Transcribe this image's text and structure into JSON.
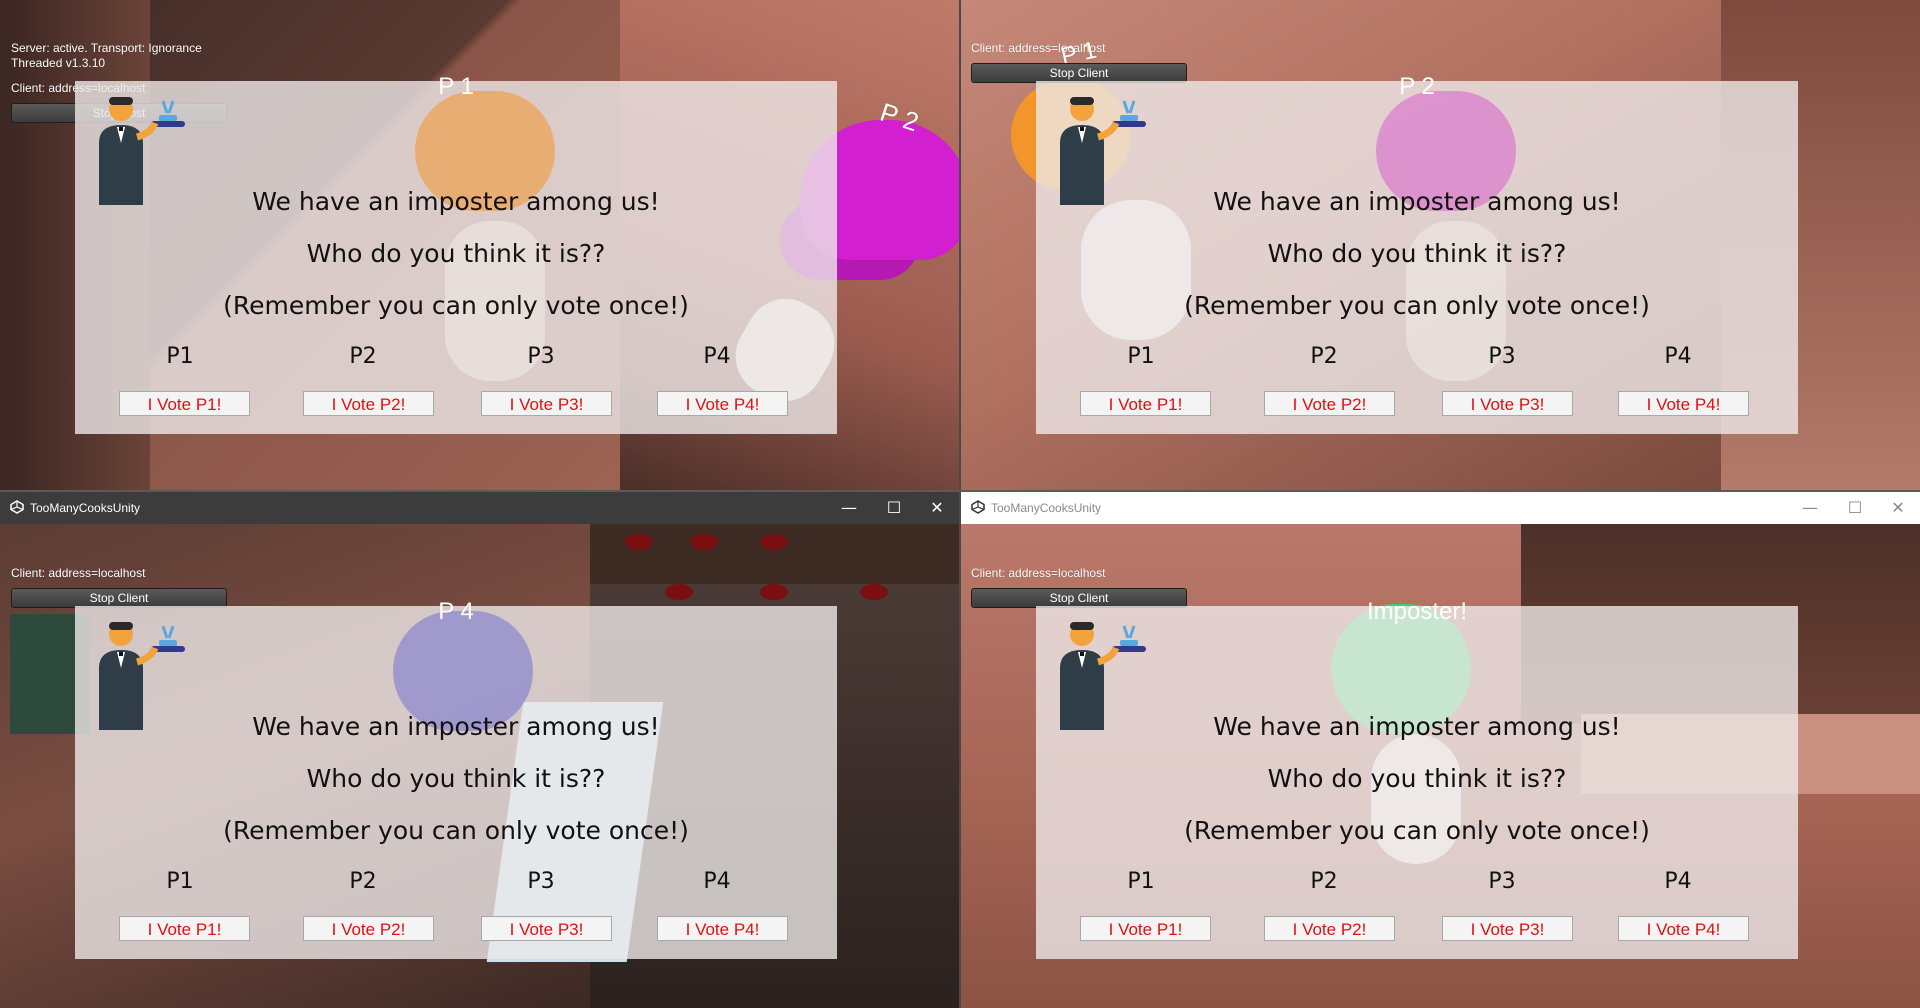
{
  "window": {
    "title": "TooManyCooksUnity",
    "minimize": "—",
    "maximize": "☐",
    "close": "✕"
  },
  "vote": {
    "line1": "We have an imposter among us!",
    "line2": "Who do you think it is??",
    "line3": "(Remember you can only vote once!)",
    "players": [
      "P1",
      "P2",
      "P3",
      "P4"
    ],
    "buttons": [
      "I Vote P1!",
      "I Vote P2!",
      "I Vote P3!",
      "I Vote P4!"
    ]
  },
  "panes": {
    "top_left": {
      "server_line1": "Server: active. Transport: Ignorance",
      "server_line2": "Threaded v1.3.10",
      "client": "Client: address=localhost",
      "button": "Stop Host",
      "banner": "P 1",
      "floating_label": "P 2"
    },
    "top_right": {
      "client": "Client: address=localhost",
      "button": "Stop Client",
      "banner": "P 2",
      "floating_label": "P 1"
    },
    "bottom_left": {
      "client": "Client: address=localhost",
      "button": "Stop Client",
      "banner": "P 4"
    },
    "bottom_right": {
      "client": "Client: address=localhost",
      "button": "Stop Client",
      "banner": "Imposter!"
    }
  },
  "colors": {
    "vote_button_text": "#e01010",
    "hat_p1": "#f2962c",
    "hat_p2": "#d21fcf",
    "hat_p3": "#2fd86a",
    "hat_p4": "#3b3fd8"
  }
}
